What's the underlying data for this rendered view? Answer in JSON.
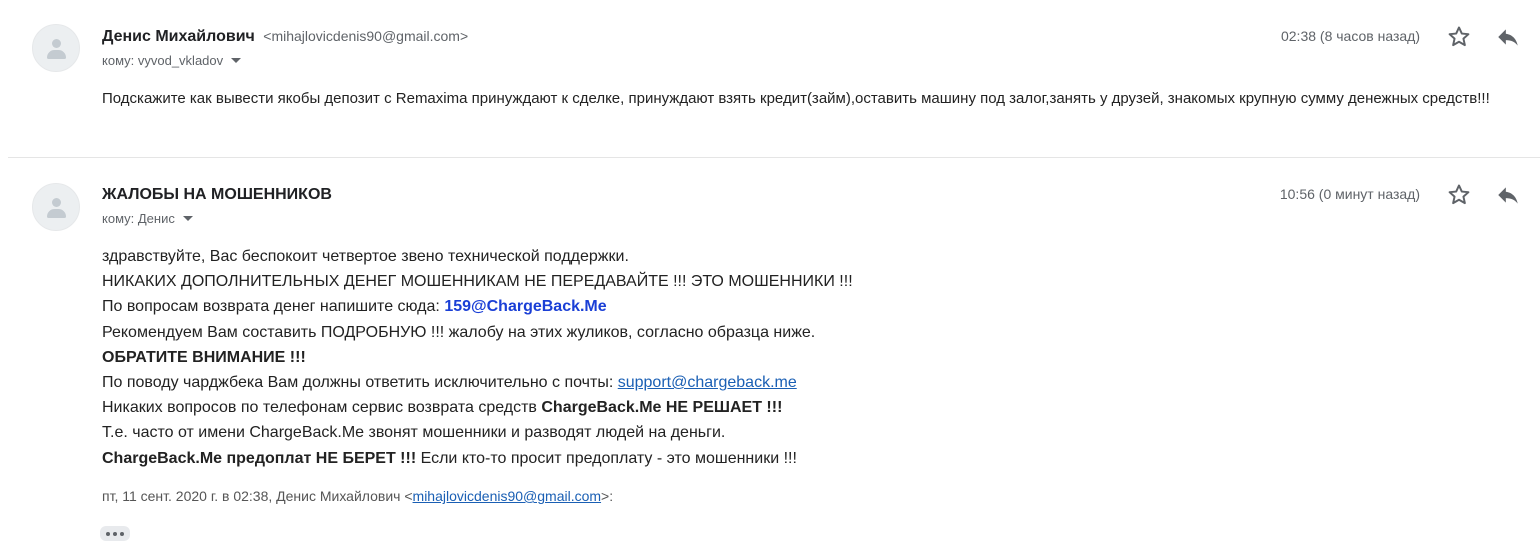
{
  "colors": {
    "link": "#1a5fb4",
    "highlight_email": "#1a3fd6",
    "text": "#222222",
    "meta": "#5f6368",
    "divider": "#e5e5e5"
  },
  "messages": [
    {
      "sender_name": "Денис Михайлович",
      "sender_email": "<mihajlovicdenis90@gmail.com>",
      "to": "кому: vyvod_vkladov",
      "time": "02:38 (8 часов назад)",
      "icons": [
        "avatar-icon",
        "star-icon",
        "reply-icon",
        "chevron-down-icon"
      ],
      "body": "Подскажите как вывести якобы депозит с Remaxima принуждают к сделке, принуждают взять кредит(займ),оставить машину под залог,занять у друзей, знакомых крупную сумму денежных средств!!!"
    },
    {
      "sender_name": "ЖАЛОБЫ НА МОШЕННИКОВ",
      "to": "кому: Денис",
      "time": "10:56 (0 минут назад)",
      "icons": [
        "avatar-icon",
        "star-icon",
        "reply-icon",
        "chevron-down-icon",
        "more-icon"
      ],
      "body": {
        "line1": "здравствуйте, Вас беспокоит четвертое звено технической поддержки.",
        "line2": "НИКАКИХ ДОПОЛНИТЕЛЬНЫХ ДЕНЕГ МОШЕННИКАМ НЕ ПЕРЕДАВАЙТЕ !!! ЭТО МОШЕННИКИ !!!",
        "line3_text": "По вопросам возврата денег напишите сюда: ",
        "line3_email": "159@ChargeBack.Me",
        "line4": "Рекомендуем Вам составить ПОДРОБНУЮ !!! жалобу на этих жуликов, согласно образца ниже.",
        "line5": "ОБРАТИТЕ ВНИМАНИЕ !!!",
        "line6_text": "По поводу чарджбека Вам должны ответить исключительно с почты: ",
        "line6_link": "support@chargeback.me",
        "line7_text": "Никаких вопросов по телефонам сервис возврата средств ",
        "line7_bold": "ChargeBack.Me НЕ РЕШАЕТ !!!",
        "line8": "Т.е. часто от имени ChargeBack.Me звонят мошенники и разводят людей на деньги.",
        "line9_bold": "ChargeBack.Me предоплат НЕ БЕРЕТ !!!",
        "line9_text": " Если кто-то просит предоплату - это мошенники !!!"
      },
      "quote": {
        "prefix": "пт, 11 сент. 2020 г. в 02:38, Денис Михайлович <",
        "email": "mihajlovicdenis90@gmail.com",
        "suffix": ">:"
      }
    }
  ]
}
